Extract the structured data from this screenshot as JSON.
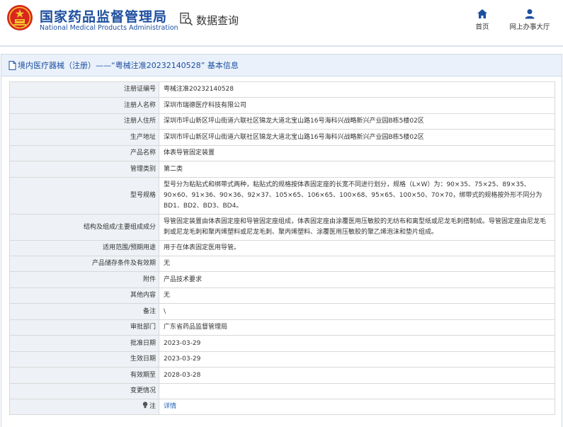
{
  "header": {
    "brand_cn": "国家药品监督管理局",
    "brand_en": "National Medical Products Administration",
    "module_title": "数据查询",
    "nav": [
      {
        "label": "首页",
        "icon": "home-icon"
      },
      {
        "label": "网上办事大厅",
        "icon": "user-icon"
      }
    ]
  },
  "panel": {
    "title": "境内医疗器械（注册）——“粤械注准20232140528” 基本信息"
  },
  "rows": [
    {
      "label": "注册证编号",
      "value": "粤械注准20232140528",
      "h": 22
    },
    {
      "label": "注册人名称",
      "value": "深圳市瑞德医疗科技有限公司",
      "h": 23
    },
    {
      "label": "注册人住所",
      "value": "深圳市坪山新区坪山街道六联社区锦龙大道北宝山路16号海科兴战略新兴产业园B栋5楼02区",
      "h": 22
    },
    {
      "label": "生产地址",
      "value": "深圳市坪山新区坪山街道六联社区锦龙大道北宝山路16号海科兴战略新兴产业园B栋5楼02区",
      "h": 23
    },
    {
      "label": "产品名称",
      "value": "体表导管固定装置",
      "h": 22
    },
    {
      "label": "管理类别",
      "value": "第二类",
      "h": 23
    },
    {
      "label": "型号规格",
      "value": "型号分为粘贴式和绑带式两种，粘贴式的规格按体表固定座的长宽不同进行划分，规格（L×W）为：90×35、75×25、89×35、90×60、91×36、90×36、92×37、105×65、106×65、100×68、95×65、100×50、70×70，绑带式的规格按外形不同分为BD1、BD2、BD3、BD4。",
      "h": 52
    },
    {
      "label": "结构及组成/主要组成成分",
      "value": "导管固定装置由体表固定座和导管固定座组成，体表固定座由涂覆医用压敏胶的无纺布和离型纸或尼龙毛刺搭制成。导管固定座由尼龙毛刺或尼龙毛刺和聚丙烯塑料或尼龙毛刺、聚丙烯塑料、涂覆医用压敏胶的聚乙烯泡沫和垫片组成。",
      "h": 37
    },
    {
      "label": "适用范围/预期用途",
      "value": "用于在体表固定医用导管。",
      "h": 22
    },
    {
      "label": "产品储存条件及有效期",
      "value": "无",
      "h": 22
    },
    {
      "label": "附件",
      "value": "产品技术要求",
      "h": 23
    },
    {
      "label": "其他内容",
      "value": "无",
      "h": 22
    },
    {
      "label": "备注",
      "value": "\\",
      "h": 23
    },
    {
      "label": "审批部门",
      "value": "广东省药品监督管理局",
      "h": 22
    },
    {
      "label": "批准日期",
      "value": "2023-03-29",
      "h": 23
    },
    {
      "label": "生效日期",
      "value": "2023-03-29",
      "h": 22
    },
    {
      "label": "有效期至",
      "value": "2028-03-28",
      "h": 23
    },
    {
      "label": "变更情况",
      "value": "",
      "h": 22
    },
    {
      "label": "注",
      "value": "详情",
      "h": 22,
      "icon": "bulb-icon",
      "link": true
    }
  ]
}
